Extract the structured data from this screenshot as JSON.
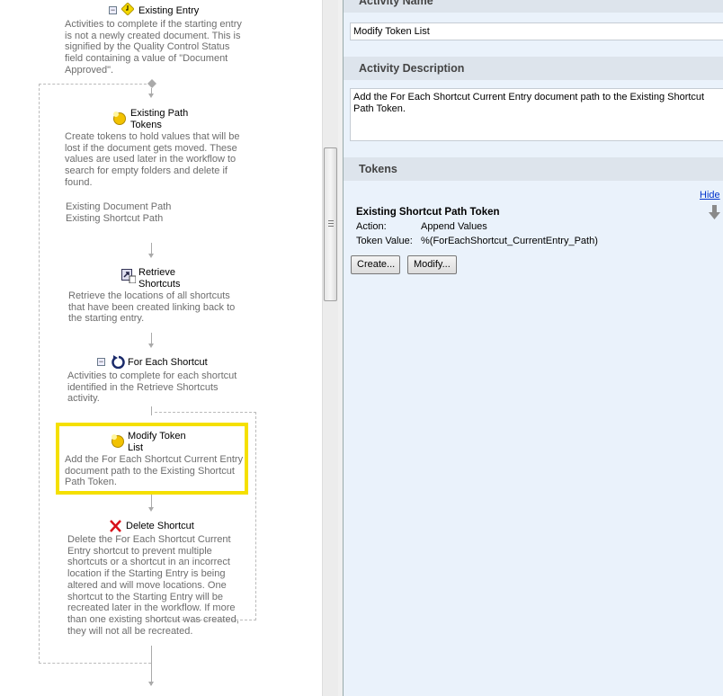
{
  "workflow": {
    "existing_entry": {
      "title": "Existing Entry",
      "desc": "Activities to complete if the starting entry\nis not a newly created document.  This is\nsignified by the Quality Control Status\nfield containing a value of \"Document\nApproved\"."
    },
    "existing_path_tokens": {
      "title": "Existing Path\nTokens",
      "desc": "Create tokens to hold values that will be\nlost if the document gets moved.  These\nvalues are used later in the workflow to\nsearch for empty folders and delete if\nfound.",
      "tokens": "Existing Document Path\nExisting Shortcut Path"
    },
    "retrieve_shortcuts": {
      "title": "Retrieve\nShortcuts",
      "desc": "Retrieve the locations of all shortcuts\nthat have been created linking back to\nthe starting entry."
    },
    "for_each_shortcut": {
      "title": "For Each Shortcut",
      "desc": "Activities to complete for each shortcut\nidentified in the Retrieve Shortcuts\nactivity."
    },
    "modify_token_list": {
      "title": "Modify Token\nList",
      "desc": "Add the For Each Shortcut Current Entry\ndocument path to the Existing Shortcut\nPath Token."
    },
    "delete_shortcut": {
      "title": "Delete Shortcut",
      "desc": "Delete the For Each Shortcut Current\nEntry shortcut to prevent multiple\nshortcuts or a shortcut in an incorrect\nlocation if the Starting Entry is being\naltered and will move locations.  One\nshortcut to the Starting Entry will be\nrecreated later in the workflow.  If more\nthan one existing shortcut was created,\nthey will not all be recreated."
    }
  },
  "properties": {
    "activity_name_header": "Activity Name",
    "activity_name_value": "Modify Token List",
    "activity_description_header": "Activity Description",
    "activity_description_value": "Add the For Each Shortcut Current Entry document path to the Existing Shortcut Path Token.",
    "tokens_header": "Tokens",
    "hide_link": "Hide",
    "token": {
      "name": "Existing Shortcut Path Token",
      "action_label": "Action:",
      "action_value": "Append Values",
      "value_label": "Token Value:",
      "value": "%(ForEachShortcut_CurrentEntry_Path)"
    },
    "create_button": "Create...",
    "modify_button": "Modify..."
  },
  "colors": {
    "selection": "#f5e000",
    "panel_bg": "#eaf2fb"
  }
}
